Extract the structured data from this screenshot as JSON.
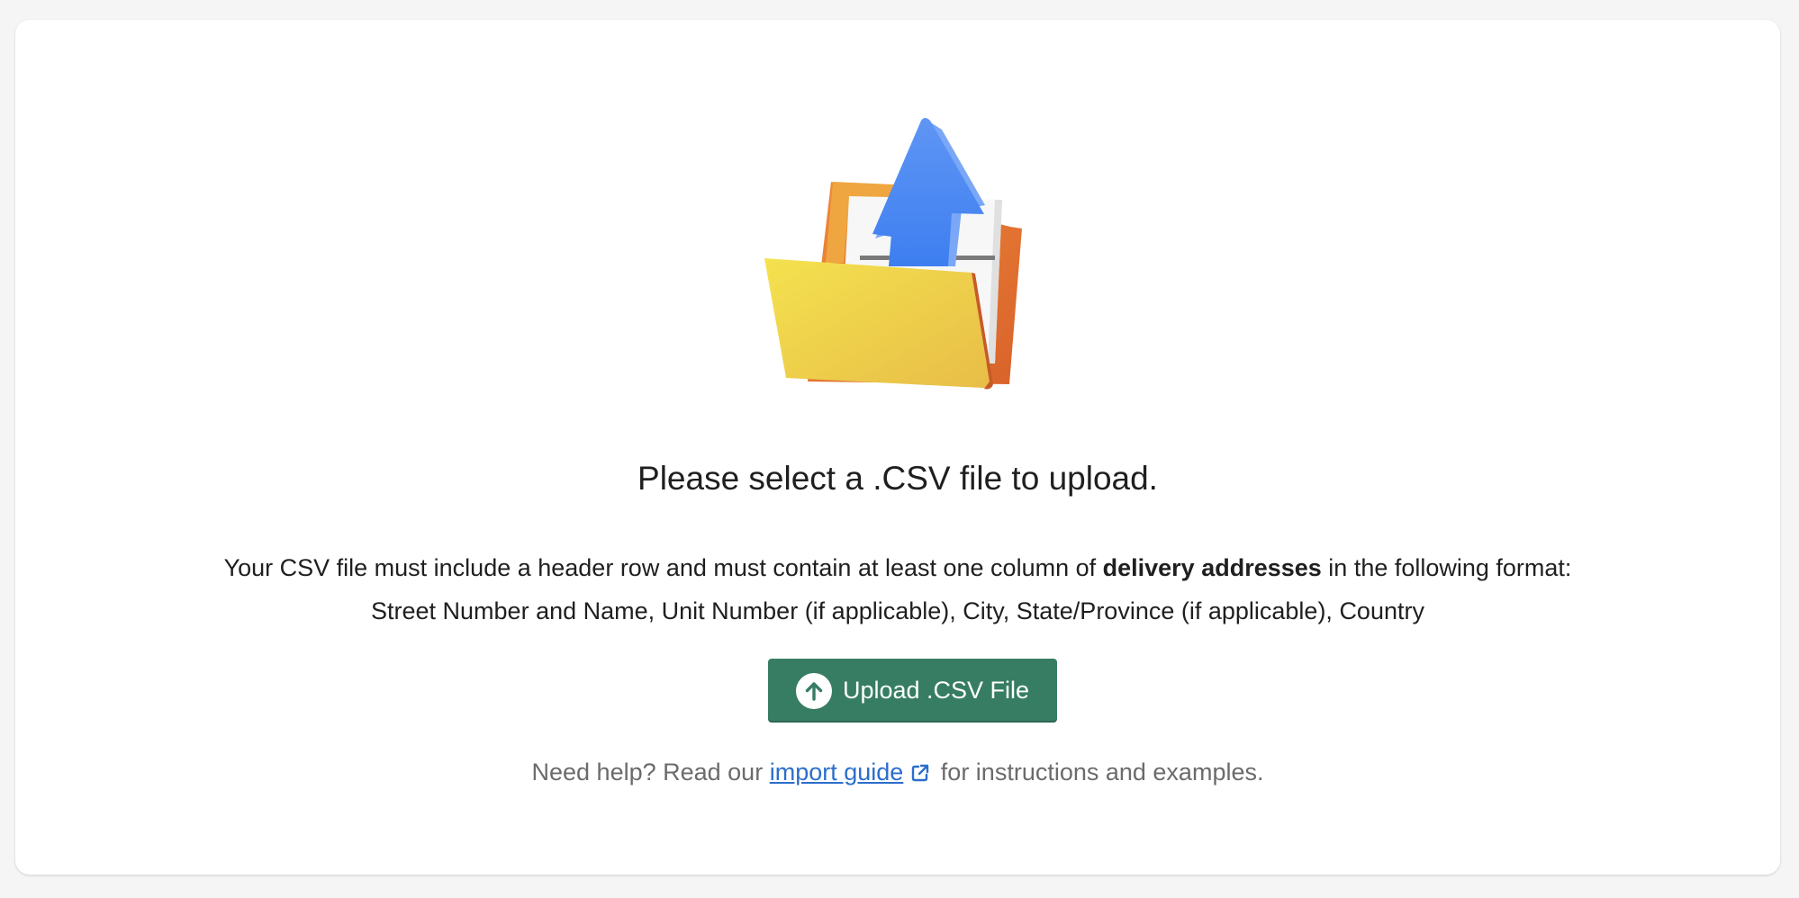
{
  "upload_panel": {
    "illustration_icon": "folder-upload-icon",
    "heading": "Please select a .CSV file to upload.",
    "description": {
      "part1": "Your CSV file must include a header row and must contain at least one column of ",
      "bold": "delivery addresses",
      "part2": " in the following format:",
      "format": "Street Number and Name, Unit Number (if applicable), City, State/Province (if applicable), Country"
    },
    "upload_button": {
      "label": "Upload .CSV File",
      "icon": "arrow-up-circle-icon",
      "color": "#367d63"
    },
    "help": {
      "prefix": "Need help? Read our",
      "link_text": "import guide",
      "link_icon": "external-link-icon",
      "suffix": " for instructions and examples."
    }
  },
  "colors": {
    "background": "#f5f5f5",
    "card": "#ffffff",
    "link": "#2c6ecb",
    "text": "#1f1f1f",
    "muted_text": "#6b6b6b"
  }
}
